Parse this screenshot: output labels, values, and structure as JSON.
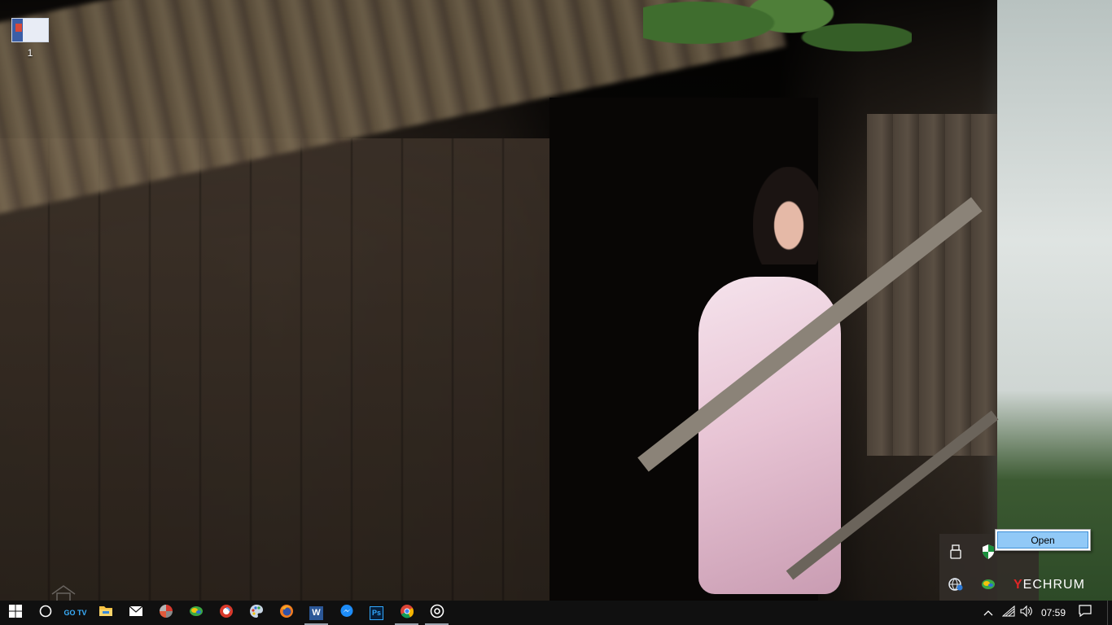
{
  "desktop": {
    "icons": [
      {
        "label": "1",
        "icon": "document-thumbnail-icon"
      }
    ]
  },
  "tray_overflow": {
    "icons": [
      "usb-drive-icon",
      "security-shield-icon",
      "vpn-globe-icon",
      "colorful-circle-app-icon",
      "techrum-app-icon"
    ],
    "brand": {
      "mark": "Y",
      "text": "ECHRUM"
    }
  },
  "context_menu": {
    "items": [
      {
        "label": "Open",
        "highlighted": true
      }
    ]
  },
  "taskbar": {
    "buttons": [
      {
        "name": "start-button",
        "icon": "windows-logo-icon"
      },
      {
        "name": "cortana-button",
        "icon": "cortana-circle-icon"
      },
      {
        "name": "gotv-button",
        "icon": "gotv-icon",
        "label": "GO TV"
      },
      {
        "name": "file-explorer-button",
        "icon": "folder-icon"
      },
      {
        "name": "mail-button",
        "icon": "mail-icon"
      },
      {
        "name": "app-red-button",
        "icon": "red-pinwheel-icon"
      },
      {
        "name": "app-green-button",
        "icon": "green-circle-icon"
      },
      {
        "name": "app-chrome-red-button",
        "icon": "red-swirl-icon"
      },
      {
        "name": "paint-button",
        "icon": "paint-palette-icon"
      },
      {
        "name": "firefox-button",
        "icon": "firefox-icon"
      },
      {
        "name": "word-button",
        "icon": "word-icon",
        "label": "W",
        "active": true
      },
      {
        "name": "messenger-button",
        "icon": "messenger-icon"
      },
      {
        "name": "photoshop-button",
        "icon": "photoshop-icon",
        "label": "Ps"
      },
      {
        "name": "chrome-button",
        "icon": "chrome-icon",
        "active": true
      },
      {
        "name": "groove-button",
        "icon": "target-circle-icon",
        "active": true
      }
    ],
    "tray": {
      "icons": [
        "chevron-up-icon",
        "wifi-icon",
        "volume-icon",
        "action-center-icon"
      ],
      "time": "07:59"
    }
  },
  "colors": {
    "taskbar_bg": "#101010",
    "menu_highlight": "#91c9f7",
    "menu_highlight_border": "#3f8fd6",
    "brand_accent": "#e02626"
  }
}
